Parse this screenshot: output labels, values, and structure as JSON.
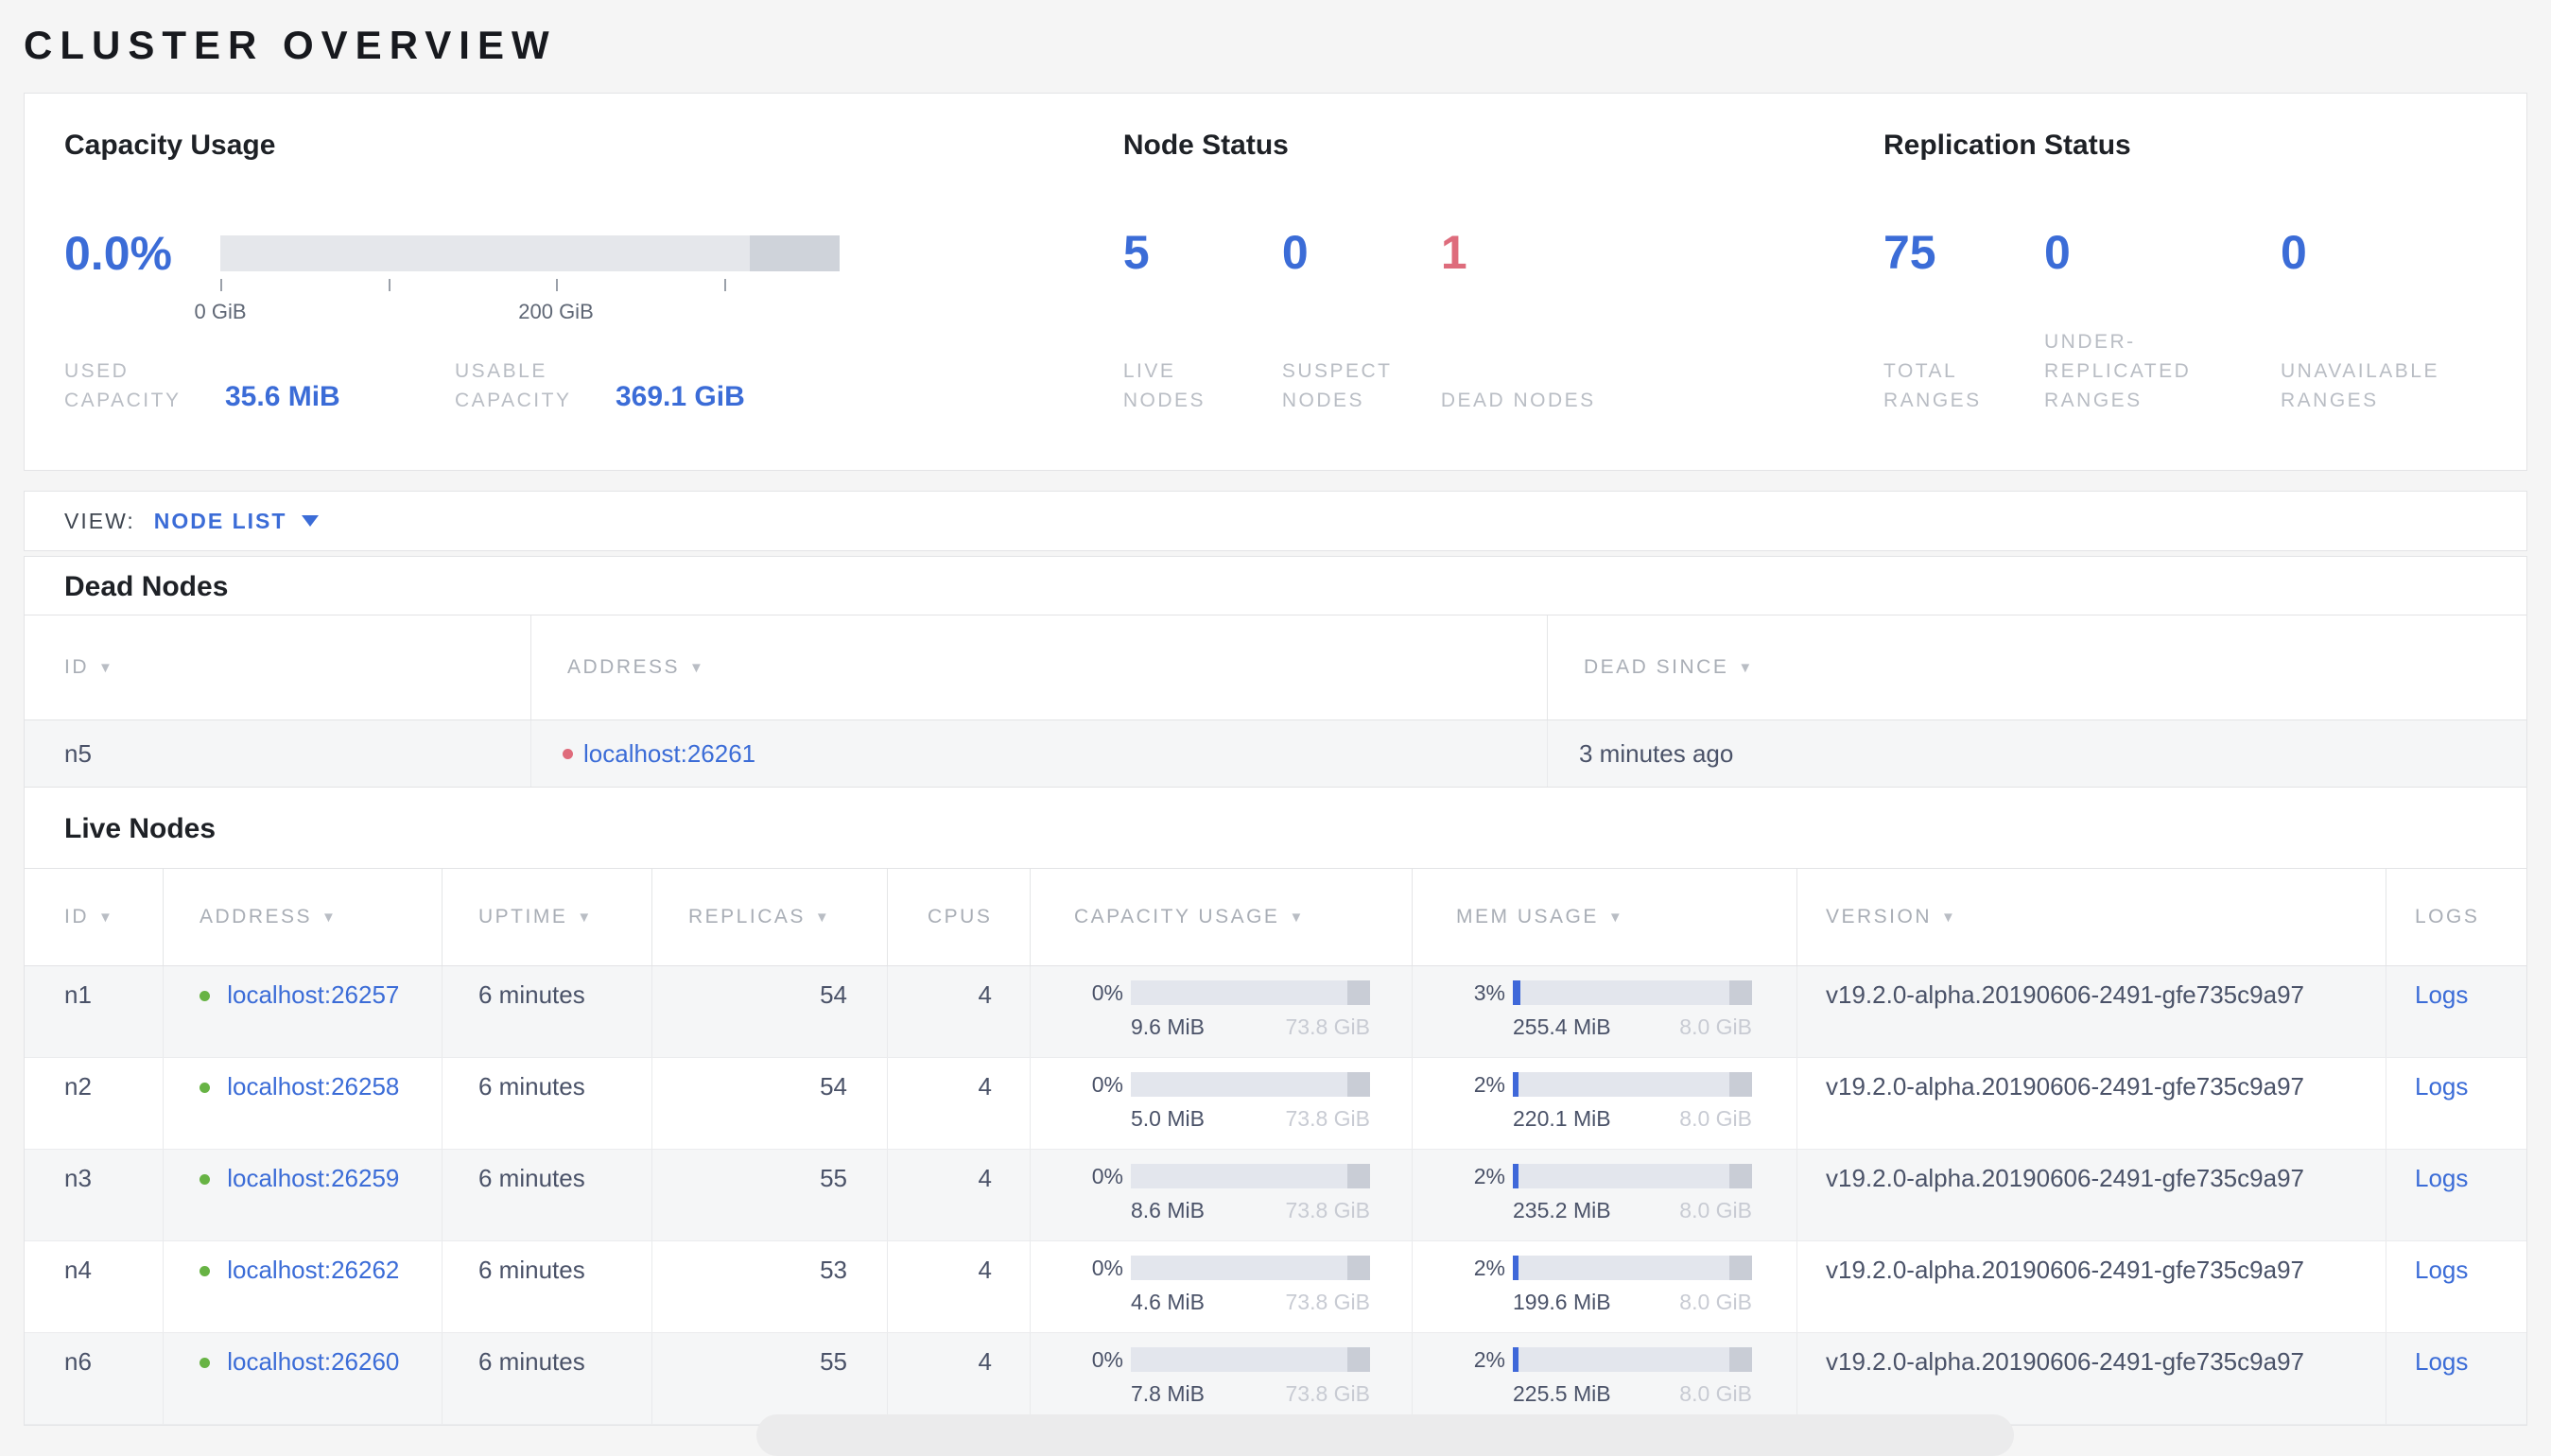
{
  "page_title": "CLUSTER OVERVIEW",
  "colors": {
    "accent_blue": "#3b6cd7",
    "alert_red": "#de6c7c",
    "live_green": "#67b344"
  },
  "summary": {
    "capacity": {
      "title": "Capacity Usage",
      "percent": "0.0%",
      "ticks": [
        {
          "label": "0 GiB",
          "pos": 0
        },
        {
          "label": "",
          "pos": 27.1
        },
        {
          "label": "200 GiB",
          "pos": 54.2
        },
        {
          "label": "",
          "pos": 81.3
        }
      ],
      "stats": [
        {
          "label": "USED CAPACITY",
          "value": "35.6 MiB"
        },
        {
          "label": "USABLE CAPACITY",
          "value": "369.1 GiB"
        }
      ]
    },
    "node_status": {
      "title": "Node Status",
      "stats": [
        {
          "value": "5",
          "label": "LIVE NODES",
          "tone": "blue"
        },
        {
          "value": "0",
          "label": "SUSPECT NODES",
          "tone": "blue"
        },
        {
          "value": "1",
          "label": "DEAD NODES",
          "tone": "red"
        }
      ]
    },
    "replication": {
      "title": "Replication Status",
      "stats": [
        {
          "value": "75",
          "label": "TOTAL RANGES",
          "tone": "blue"
        },
        {
          "value": "0",
          "label": "UNDER-REPLICATED RANGES",
          "tone": "blue"
        },
        {
          "value": "0",
          "label": "UNAVAILABLE RANGES",
          "tone": "blue"
        }
      ]
    }
  },
  "view_bar": {
    "label": "VIEW:",
    "selected": "NODE LIST"
  },
  "dead_nodes": {
    "title": "Dead Nodes",
    "columns": [
      {
        "label": "ID",
        "sortable": true
      },
      {
        "label": "ADDRESS",
        "sortable": true
      },
      {
        "label": "DEAD SINCE",
        "sortable": true
      }
    ],
    "rows": [
      {
        "id": "n5",
        "address": "localhost:26261",
        "dead_since": "3 minutes ago"
      }
    ]
  },
  "live_nodes": {
    "title": "Live Nodes",
    "columns": [
      {
        "label": "ID",
        "sortable": true
      },
      {
        "label": "ADDRESS",
        "sortable": true
      },
      {
        "label": "UPTIME",
        "sortable": true
      },
      {
        "label": "REPLICAS",
        "sortable": true
      },
      {
        "label": "CPUS",
        "sortable": false
      },
      {
        "label": "CAPACITY USAGE",
        "sortable": true
      },
      {
        "label": "MEM USAGE",
        "sortable": true
      },
      {
        "label": "VERSION",
        "sortable": true
      },
      {
        "label": "LOGS",
        "sortable": false
      }
    ],
    "rows": [
      {
        "id": "n1",
        "address": "localhost:26257",
        "uptime": "6 minutes",
        "replicas": "54",
        "cpus": "4",
        "capacity_percent": "0%",
        "capacity_used": "9.6 MiB",
        "capacity_total": "73.8 GiB",
        "mem_percent": "3%",
        "mem_used": "255.4 MiB",
        "mem_total": "8.0 GiB",
        "version": "v19.2.0-alpha.20190606-2491-gfe735c9a97",
        "logs_label": "Logs"
      },
      {
        "id": "n2",
        "address": "localhost:26258",
        "uptime": "6 minutes",
        "replicas": "54",
        "cpus": "4",
        "capacity_percent": "0%",
        "capacity_used": "5.0 MiB",
        "capacity_total": "73.8 GiB",
        "mem_percent": "2%",
        "mem_used": "220.1 MiB",
        "mem_total": "8.0 GiB",
        "version": "v19.2.0-alpha.20190606-2491-gfe735c9a97",
        "logs_label": "Logs"
      },
      {
        "id": "n3",
        "address": "localhost:26259",
        "uptime": "6 minutes",
        "replicas": "55",
        "cpus": "4",
        "capacity_percent": "0%",
        "capacity_used": "8.6 MiB",
        "capacity_total": "73.8 GiB",
        "mem_percent": "2%",
        "mem_used": "235.2 MiB",
        "mem_total": "8.0 GiB",
        "version": "v19.2.0-alpha.20190606-2491-gfe735c9a97",
        "logs_label": "Logs"
      },
      {
        "id": "n4",
        "address": "localhost:26262",
        "uptime": "6 minutes",
        "replicas": "53",
        "cpus": "4",
        "capacity_percent": "0%",
        "capacity_used": "4.6 MiB",
        "capacity_total": "73.8 GiB",
        "mem_percent": "2%",
        "mem_used": "199.6 MiB",
        "mem_total": "8.0 GiB",
        "version": "v19.2.0-alpha.20190606-2491-gfe735c9a97",
        "logs_label": "Logs"
      },
      {
        "id": "n6",
        "address": "localhost:26260",
        "uptime": "6 minutes",
        "replicas": "55",
        "cpus": "4",
        "capacity_percent": "0%",
        "capacity_used": "7.8 MiB",
        "capacity_total": "73.8 GiB",
        "mem_percent": "2%",
        "mem_used": "225.5 MiB",
        "mem_total": "8.0 GiB",
        "version": "v19.2.0-alpha.20190606-2491-gfe735c9a97",
        "logs_label": "Logs"
      }
    ]
  }
}
